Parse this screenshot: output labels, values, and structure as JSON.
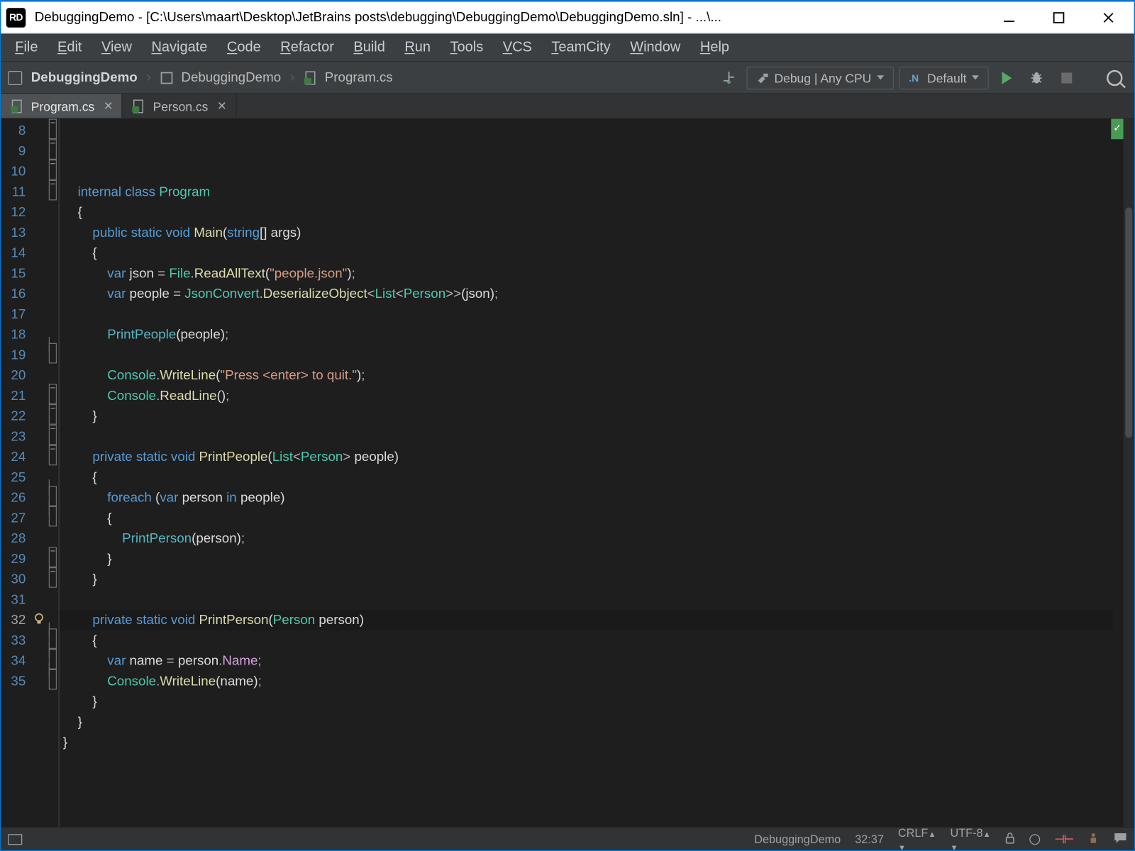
{
  "titlebar": {
    "badge": "RD",
    "text": "DebuggingDemo - [C:\\Users\\maart\\Desktop\\JetBrains posts\\debugging\\DebuggingDemo\\DebuggingDemo.sln] - ...\\..."
  },
  "menu": [
    "File",
    "Edit",
    "View",
    "Navigate",
    "Code",
    "Refactor",
    "Build",
    "Run",
    "Tools",
    "VCS",
    "TeamCity",
    "Window",
    "Help"
  ],
  "breadcrumb": {
    "solution": "DebuggingDemo",
    "project": "DebuggingDemo",
    "file": "Program.cs"
  },
  "toolbar": {
    "config": "Debug | Any CPU",
    "runconfig": "Default"
  },
  "tabs": [
    {
      "name": "Program.cs",
      "active": true
    },
    {
      "name": "Person.cs",
      "active": false
    }
  ],
  "gutter": {
    "start": 8,
    "end": 35,
    "current": 32,
    "bulb_at": 32
  },
  "code": [
    [
      [
        "    ",
        ""
      ],
      [
        "internal",
        "kw"
      ],
      [
        " ",
        ""
      ],
      [
        "class",
        "kw"
      ],
      [
        " ",
        ""
      ],
      [
        "Program",
        "ty"
      ]
    ],
    [
      [
        "    ",
        ""
      ],
      [
        "{",
        "br"
      ]
    ],
    [
      [
        "        ",
        ""
      ],
      [
        "public",
        "kw"
      ],
      [
        " ",
        ""
      ],
      [
        "static",
        "kw"
      ],
      [
        " ",
        ""
      ],
      [
        "void",
        "kw"
      ],
      [
        " ",
        ""
      ],
      [
        "Main",
        "fn"
      ],
      [
        "(",
        "br"
      ],
      [
        "string",
        "kw"
      ],
      [
        "[] ",
        "br"
      ],
      [
        "args",
        "id"
      ],
      [
        ")",
        "br"
      ]
    ],
    [
      [
        "        ",
        ""
      ],
      [
        "{",
        "br"
      ]
    ],
    [
      [
        "            ",
        ""
      ],
      [
        "var",
        "kw"
      ],
      [
        " ",
        ""
      ],
      [
        "json",
        "id"
      ],
      [
        " ",
        ""
      ],
      [
        "=",
        "op"
      ],
      [
        " ",
        ""
      ],
      [
        "File",
        "ty"
      ],
      [
        ".",
        "op"
      ],
      [
        "ReadAllText",
        "fn"
      ],
      [
        "(",
        "br"
      ],
      [
        "\"people.json\"",
        "str"
      ],
      [
        ")",
        "br"
      ],
      [
        ";",
        "op"
      ]
    ],
    [
      [
        "            ",
        ""
      ],
      [
        "var",
        "kw"
      ],
      [
        " ",
        ""
      ],
      [
        "people",
        "id"
      ],
      [
        " ",
        ""
      ],
      [
        "=",
        "op"
      ],
      [
        " ",
        ""
      ],
      [
        "JsonConvert",
        "ty"
      ],
      [
        ".",
        "op"
      ],
      [
        "DeserializeObject",
        "fn"
      ],
      [
        "<",
        "op"
      ],
      [
        "List",
        "ty"
      ],
      [
        "<",
        "op"
      ],
      [
        "Person",
        "ty"
      ],
      [
        ">>",
        "op"
      ],
      [
        "(",
        "br"
      ],
      [
        "json",
        "id"
      ],
      [
        ")",
        "br"
      ],
      [
        ";",
        "op"
      ]
    ],
    [
      [
        "",
        ""
      ]
    ],
    [
      [
        "            ",
        ""
      ],
      [
        "PrintPeople",
        "mc"
      ],
      [
        "(",
        "br"
      ],
      [
        "people",
        "id"
      ],
      [
        ")",
        "br"
      ],
      [
        ";",
        "op"
      ]
    ],
    [
      [
        "",
        ""
      ]
    ],
    [
      [
        "            ",
        ""
      ],
      [
        "Console",
        "ty"
      ],
      [
        ".",
        "op"
      ],
      [
        "WriteLine",
        "fn"
      ],
      [
        "(",
        "br"
      ],
      [
        "\"Press <enter> to quit.\"",
        "str"
      ],
      [
        ")",
        "br"
      ],
      [
        ";",
        "op"
      ]
    ],
    [
      [
        "            ",
        ""
      ],
      [
        "Console",
        "ty"
      ],
      [
        ".",
        "op"
      ],
      [
        "ReadLine",
        "fn"
      ],
      [
        "(",
        "br"
      ],
      [
        ")",
        "br"
      ],
      [
        ";",
        "op"
      ]
    ],
    [
      [
        "        ",
        ""
      ],
      [
        "}",
        "br"
      ]
    ],
    [
      [
        "",
        ""
      ]
    ],
    [
      [
        "        ",
        ""
      ],
      [
        "private",
        "kw"
      ],
      [
        " ",
        ""
      ],
      [
        "static",
        "kw"
      ],
      [
        " ",
        ""
      ],
      [
        "void",
        "kw"
      ],
      [
        " ",
        ""
      ],
      [
        "PrintPeople",
        "fn"
      ],
      [
        "(",
        "br"
      ],
      [
        "List",
        "ty"
      ],
      [
        "<",
        "op"
      ],
      [
        "Person",
        "ty"
      ],
      [
        "> ",
        "op"
      ],
      [
        "people",
        "id"
      ],
      [
        ")",
        "br"
      ]
    ],
    [
      [
        "        ",
        ""
      ],
      [
        "{",
        "br"
      ]
    ],
    [
      [
        "            ",
        ""
      ],
      [
        "foreach",
        "kw"
      ],
      [
        " ",
        ""
      ],
      [
        "(",
        "br"
      ],
      [
        "var",
        "kw"
      ],
      [
        " ",
        ""
      ],
      [
        "person",
        "id"
      ],
      [
        " ",
        ""
      ],
      [
        "in",
        "kw"
      ],
      [
        " ",
        ""
      ],
      [
        "people",
        "id"
      ],
      [
        ")",
        "br"
      ]
    ],
    [
      [
        "            ",
        ""
      ],
      [
        "{",
        "br"
      ]
    ],
    [
      [
        "                ",
        ""
      ],
      [
        "PrintPerson",
        "mc"
      ],
      [
        "(",
        "br"
      ],
      [
        "person",
        "id"
      ],
      [
        ")",
        "br"
      ],
      [
        ";",
        "op"
      ]
    ],
    [
      [
        "            ",
        ""
      ],
      [
        "}",
        "br"
      ]
    ],
    [
      [
        "        ",
        ""
      ],
      [
        "}",
        "br"
      ]
    ],
    [
      [
        "",
        ""
      ]
    ],
    [
      [
        "        ",
        ""
      ],
      [
        "private",
        "kw"
      ],
      [
        " ",
        ""
      ],
      [
        "static",
        "kw"
      ],
      [
        " ",
        ""
      ],
      [
        "void",
        "kw"
      ],
      [
        " ",
        ""
      ],
      [
        "PrintPerson",
        "fn"
      ],
      [
        "(",
        "br"
      ],
      [
        "Person",
        "ty"
      ],
      [
        " ",
        ""
      ],
      [
        "person",
        "id"
      ],
      [
        ")",
        "br"
      ]
    ],
    [
      [
        "        ",
        ""
      ],
      [
        "{",
        "br"
      ]
    ],
    [
      [
        "            ",
        ""
      ],
      [
        "var",
        "kw"
      ],
      [
        " ",
        ""
      ],
      [
        "name",
        "id"
      ],
      [
        " ",
        ""
      ],
      [
        "=",
        "op"
      ],
      [
        " ",
        ""
      ],
      [
        "person",
        "id"
      ],
      [
        ".",
        "op"
      ],
      [
        "Name",
        "prop"
      ],
      [
        ";",
        "op"
      ]
    ],
    [
      [
        "            ",
        ""
      ],
      [
        "Console",
        "ty"
      ],
      [
        ".",
        "op"
      ],
      [
        "WriteLine",
        "fn"
      ],
      [
        "(",
        "br"
      ],
      [
        "name",
        "id"
      ],
      [
        ")",
        "br"
      ],
      [
        ";",
        "op"
      ]
    ],
    [
      [
        "        ",
        ""
      ],
      [
        "}",
        "br"
      ]
    ],
    [
      [
        "    ",
        ""
      ],
      [
        "}",
        "br"
      ]
    ],
    [
      [
        "",
        ""
      ],
      [
        "}",
        "br"
      ]
    ]
  ],
  "status": {
    "project": "DebuggingDemo",
    "pos": "32:37",
    "lineend": "CRLF",
    "encoding": "UTF-8"
  }
}
